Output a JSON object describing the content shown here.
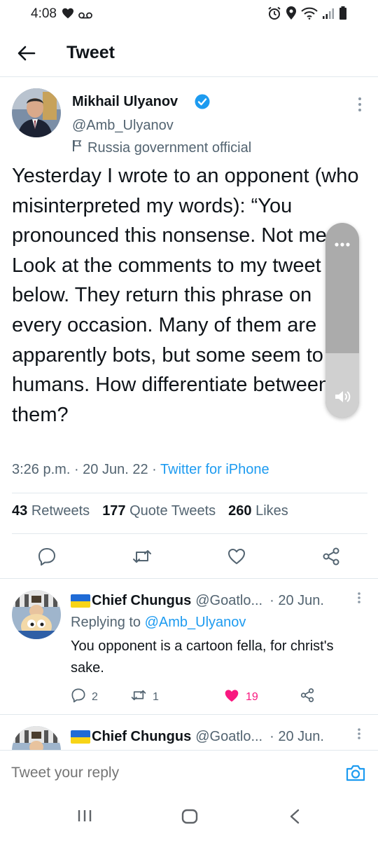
{
  "status_bar": {
    "time": "4:08"
  },
  "header": {
    "title": "Tweet"
  },
  "tweet": {
    "author_name": "Mikhail Ulyanov",
    "handle": "@Amb_Ulyanov",
    "label": "Russia government official",
    "text": "Yesterday I wrote to an opponent (who misinterpreted my words): “You pronounced this nonsense. Not me.” Look at the comments to my tweet below. They return this phrase on every occasion. Many of them are apparently bots, but some seem to be humans. How differentiate between them?",
    "time": "3:26 p.m.",
    "date": "20 Jun. 22",
    "source": "Twitter for iPhone",
    "stats": {
      "retweets_count": "43",
      "retweets_label": "Retweets",
      "quotes_count": "177",
      "quotes_label": "Quote Tweets",
      "likes_count": "260",
      "likes_label": "Likes"
    }
  },
  "replies": [
    {
      "name": "Chief Chungus",
      "handle": "@Goatlo...",
      "date": "· 20 Jun.",
      "replying_prefix": "Replying to",
      "replying_to": "@Amb_Ulyanov",
      "text": "You opponent is a cartoon fella, for christ's sake.",
      "reply_count": "2",
      "retweet_count": "1",
      "like_count": "19"
    },
    {
      "name": "Chief Chungus",
      "handle": "@Goatlo...",
      "date": "· 20 Jun."
    }
  ],
  "compose": {
    "placeholder": "Tweet your reply"
  },
  "volume": {
    "level": 0.33
  },
  "colors": {
    "accent": "#1d9bf0",
    "like": "#f91880",
    "text": "#0f1419",
    "muted": "#536471"
  }
}
